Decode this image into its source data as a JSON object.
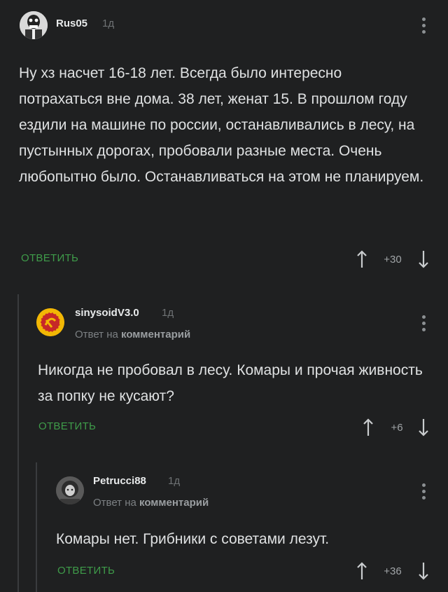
{
  "colors": {
    "background": "#1f2021",
    "accent": "#3f9c4a",
    "text": "#dfe1e2"
  },
  "comments": [
    {
      "author": "Rus05",
      "time": "1д",
      "text": "Ну хз насчет 16-18 лет. Всегда было интересно потрахаться вне дома. 38 лет, женат 15. В прошлом году ездили на машине по россии, останавливались в лесу, на пустынных дорогах, пробовали разные места. Очень любопытно было. Останавливаться на этом не планируем.",
      "reply_label": "ОТВЕТИТЬ",
      "score": "+30"
    },
    {
      "author": "sinysoidV3.0",
      "time": "1д",
      "reply_prefix": "Ответ на",
      "reply_target": "комментарий",
      "text": "Никогда не пробовал в лесу. Комары и прочая живность за попку не кусают?",
      "reply_label": "ОТВЕТИТЬ",
      "score": "+6"
    },
    {
      "author": "Petrucci88",
      "time": "1д",
      "reply_prefix": "Ответ на",
      "reply_target": "комментарий",
      "text": "Комары нет. Грибники с советами лезут.",
      "reply_label": "ОТВЕТИТЬ",
      "score": "+36"
    }
  ]
}
